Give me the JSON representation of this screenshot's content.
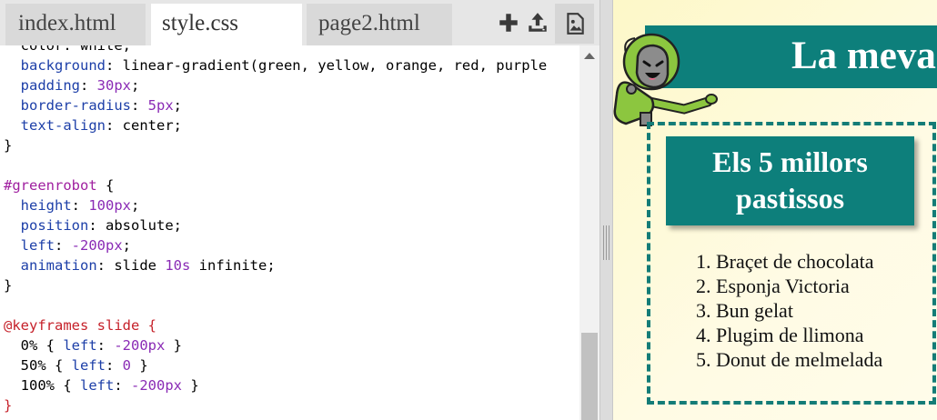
{
  "tabs": [
    {
      "label": "index.html"
    },
    {
      "label": "style.css"
    },
    {
      "label": "page2.html"
    }
  ],
  "toolbar_icons": [
    "gear-icon",
    "plus-icon",
    "upload-icon",
    "image-icon"
  ],
  "code_lines": [
    {
      "parts": [
        {
          "t": "  color: white;",
          "c": ""
        }
      ]
    },
    {
      "parts": [
        {
          "t": "  ",
          "c": ""
        },
        {
          "t": "background",
          "c": "prop"
        },
        {
          "t": ": linear-gradient(green, yellow, orange, red, purple",
          "c": ""
        }
      ]
    },
    {
      "parts": [
        {
          "t": "  ",
          "c": ""
        },
        {
          "t": "padding",
          "c": "prop"
        },
        {
          "t": ": ",
          "c": ""
        },
        {
          "t": "30px",
          "c": "num"
        },
        {
          "t": ";",
          "c": ""
        }
      ]
    },
    {
      "parts": [
        {
          "t": "  ",
          "c": ""
        },
        {
          "t": "border-radius",
          "c": "prop"
        },
        {
          "t": ": ",
          "c": ""
        },
        {
          "t": "5px",
          "c": "num"
        },
        {
          "t": ";",
          "c": ""
        }
      ]
    },
    {
      "parts": [
        {
          "t": "  ",
          "c": ""
        },
        {
          "t": "text-align",
          "c": "prop"
        },
        {
          "t": ": center;",
          "c": ""
        }
      ]
    },
    {
      "parts": [
        {
          "t": "}",
          "c": ""
        }
      ]
    },
    {
      "parts": [
        {
          "t": "",
          "c": ""
        }
      ]
    },
    {
      "parts": [
        {
          "t": "#greenrobot",
          "c": "sel"
        },
        {
          "t": " {",
          "c": ""
        }
      ]
    },
    {
      "parts": [
        {
          "t": "  ",
          "c": ""
        },
        {
          "t": "height",
          "c": "prop"
        },
        {
          "t": ": ",
          "c": ""
        },
        {
          "t": "100px",
          "c": "num"
        },
        {
          "t": ";",
          "c": ""
        }
      ]
    },
    {
      "parts": [
        {
          "t": "  ",
          "c": ""
        },
        {
          "t": "position",
          "c": "prop"
        },
        {
          "t": ": absolute;",
          "c": ""
        }
      ]
    },
    {
      "parts": [
        {
          "t": "  ",
          "c": ""
        },
        {
          "t": "left",
          "c": "prop"
        },
        {
          "t": ": ",
          "c": ""
        },
        {
          "t": "-200px",
          "c": "num"
        },
        {
          "t": ";",
          "c": ""
        }
      ]
    },
    {
      "parts": [
        {
          "t": "  ",
          "c": ""
        },
        {
          "t": "animation",
          "c": "prop"
        },
        {
          "t": ": slide ",
          "c": ""
        },
        {
          "t": "10s",
          "c": "num"
        },
        {
          "t": " infinite;",
          "c": ""
        }
      ]
    },
    {
      "parts": [
        {
          "t": "}",
          "c": ""
        }
      ]
    },
    {
      "parts": [
        {
          "t": "",
          "c": ""
        }
      ]
    },
    {
      "parts": [
        {
          "t": "@keyframes slide {",
          "c": "at"
        }
      ]
    },
    {
      "parts": [
        {
          "t": "  0% { ",
          "c": ""
        },
        {
          "t": "left",
          "c": "prop"
        },
        {
          "t": ": ",
          "c": ""
        },
        {
          "t": "-200px",
          "c": "num"
        },
        {
          "t": " }",
          "c": ""
        }
      ]
    },
    {
      "parts": [
        {
          "t": "  50% { ",
          "c": ""
        },
        {
          "t": "left",
          "c": "prop"
        },
        {
          "t": ": ",
          "c": ""
        },
        {
          "t": "0",
          "c": "num"
        },
        {
          "t": " }",
          "c": ""
        }
      ]
    },
    {
      "parts": [
        {
          "t": "  100% { ",
          "c": ""
        },
        {
          "t": "left",
          "c": "prop"
        },
        {
          "t": ": ",
          "c": ""
        },
        {
          "t": "-200px",
          "c": "num"
        },
        {
          "t": " }",
          "c": ""
        }
      ]
    },
    {
      "parts": [
        {
          "t": "}",
          "c": "at"
        }
      ]
    }
  ],
  "preview": {
    "banner_title": "La meva",
    "card_heading": "Els 5 millors pastissos",
    "cakes": [
      "Braçet de chocolata",
      "Esponja Victoria",
      "Bun gelat",
      "Plugim de llimona",
      "Donut de melmelada"
    ]
  },
  "colors": {
    "teal": "#0d7f7b",
    "robot_green": "#8cc63f",
    "preview_bg": "#fdf8c8"
  }
}
